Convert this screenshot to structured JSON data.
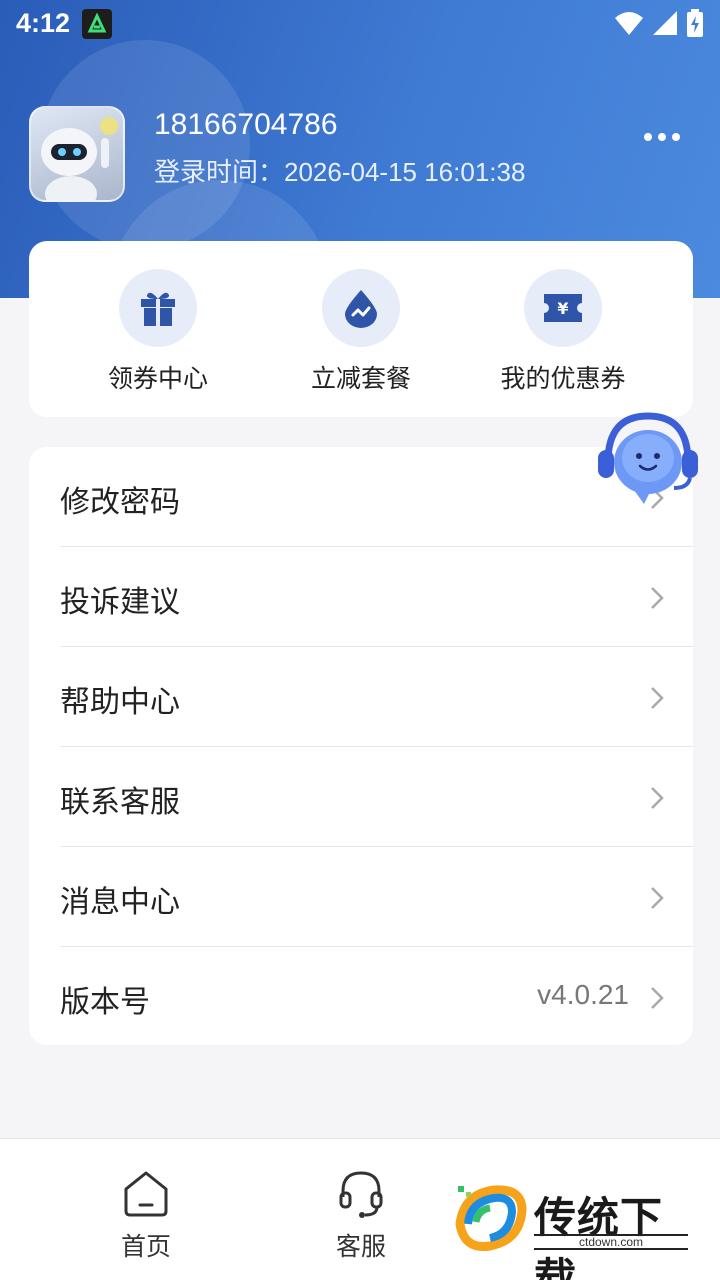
{
  "status_bar": {
    "time": "4:12"
  },
  "profile": {
    "phone": "18166704786",
    "login_time": "登录时间：2026-04-15 16:01:38"
  },
  "quick_actions": [
    {
      "label": "领券中心",
      "icon": "gift-icon"
    },
    {
      "label": "立减套餐",
      "icon": "drop-icon"
    },
    {
      "label": "我的优惠券",
      "icon": "coupon-icon"
    }
  ],
  "menu": [
    {
      "label": "修改密码"
    },
    {
      "label": "投诉建议"
    },
    {
      "label": "帮助中心"
    },
    {
      "label": "联系客服"
    },
    {
      "label": "消息中心"
    },
    {
      "label": "版本号",
      "value": "v4.0.21"
    }
  ],
  "tabs": [
    {
      "label": "首页",
      "icon": "home-icon"
    },
    {
      "label": "客服",
      "icon": "headset-icon"
    }
  ],
  "watermark": {
    "title": "传统下载",
    "url": "ctdown.com"
  },
  "colors": {
    "header_start": "#2a5cb8",
    "header_end": "#4b8ade",
    "icon_blue": "#2f55a9",
    "icon_bg": "#e6ecf8"
  }
}
